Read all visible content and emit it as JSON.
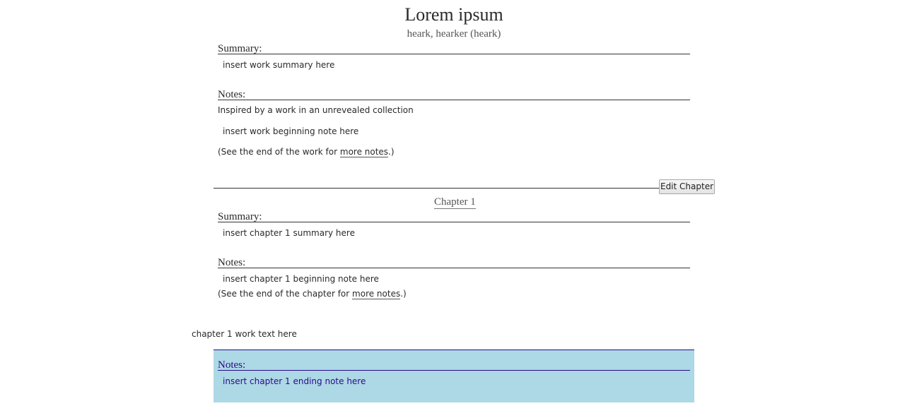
{
  "work": {
    "title": "Lorem ipsum",
    "byline": "heark, hearker (heark)",
    "summary_heading": "Summary:",
    "summary": "insert work summary here",
    "notes_heading": "Notes:",
    "inspired_by": "Inspired by a work in an unrevealed collection",
    "beginning_note": "insert work beginning note here",
    "end_notes_prefix": "(See the end of the work for ",
    "end_notes_link": "more notes",
    "end_notes_suffix": ".)"
  },
  "chapter": {
    "edit_label": "Edit Chapter",
    "title": "Chapter 1",
    "summary_heading": "Summary:",
    "summary": "insert chapter 1 summary here",
    "notes_heading": "Notes:",
    "beginning_note": "insert chapter 1 beginning note here",
    "end_notes_prefix": "(See the end of the chapter for ",
    "end_notes_link": "more notes",
    "end_notes_suffix": ".)",
    "work_text": "chapter 1 work text here",
    "end_notes_heading": "Notes:",
    "ending_note": "insert chapter 1 ending note here"
  },
  "colors": {
    "end_notes_background": "#add8e6",
    "end_notes_text": "#2a0a8a"
  }
}
